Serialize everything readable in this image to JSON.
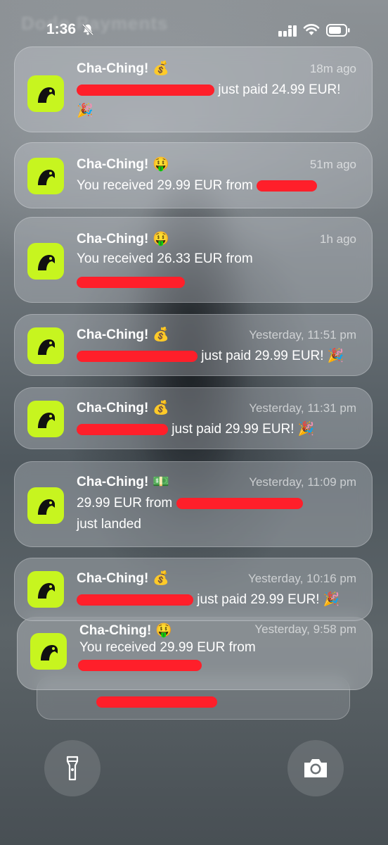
{
  "status_bar": {
    "time": "1:36",
    "signal_icon": "cellular-signal-icon",
    "wifi_icon": "wifi-icon",
    "battery_icon": "battery-icon",
    "silent_icon": "bell-slash-icon"
  },
  "background_text": "Dodo Payments",
  "app_icon": "parrot-icon",
  "brand_color": "#c7f51f",
  "redaction_color": "#ff1f2a",
  "notifications": [
    {
      "title": "Cha-Ching!",
      "emoji": "💰",
      "time": "18m ago",
      "body_after_redaction": "just paid 24.99 EUR!",
      "body_line2": "🎉"
    },
    {
      "title": "Cha-Ching!",
      "emoji": "🤑",
      "time": "51m ago",
      "body": "You received 29.99 EUR from"
    },
    {
      "title": "Cha-Ching!",
      "emoji": "🤑",
      "time": "1h ago",
      "body": "You received 26.33 EUR from"
    },
    {
      "title": "Cha-Ching!",
      "emoji": "💰",
      "time": "Yesterday, 11:51 pm",
      "body_after_redaction": "just paid 29.99 EUR! 🎉"
    },
    {
      "title": "Cha-Ching!",
      "emoji": "💰",
      "time": "Yesterday, 11:31 pm",
      "body_after_redaction": "just paid 29.99 EUR! 🎉"
    },
    {
      "title": "Cha-Ching!",
      "emoji": "💵",
      "time": "Yesterday, 11:09 pm",
      "body": "29.99 EUR from",
      "body_line2": "just landed"
    },
    {
      "title": "Cha-Ching!",
      "emoji": "💰",
      "time": "Yesterday, 10:16 pm",
      "body_after_redaction": "just paid 29.99 EUR! 🎉"
    },
    {
      "title": "Cha-Ching!",
      "emoji": "🤑",
      "time": "Yesterday, 9:58 pm",
      "body": "You received 29.99 EUR from"
    }
  ],
  "lock_buttons": {
    "left": "flashlight-icon",
    "right": "camera-icon"
  }
}
